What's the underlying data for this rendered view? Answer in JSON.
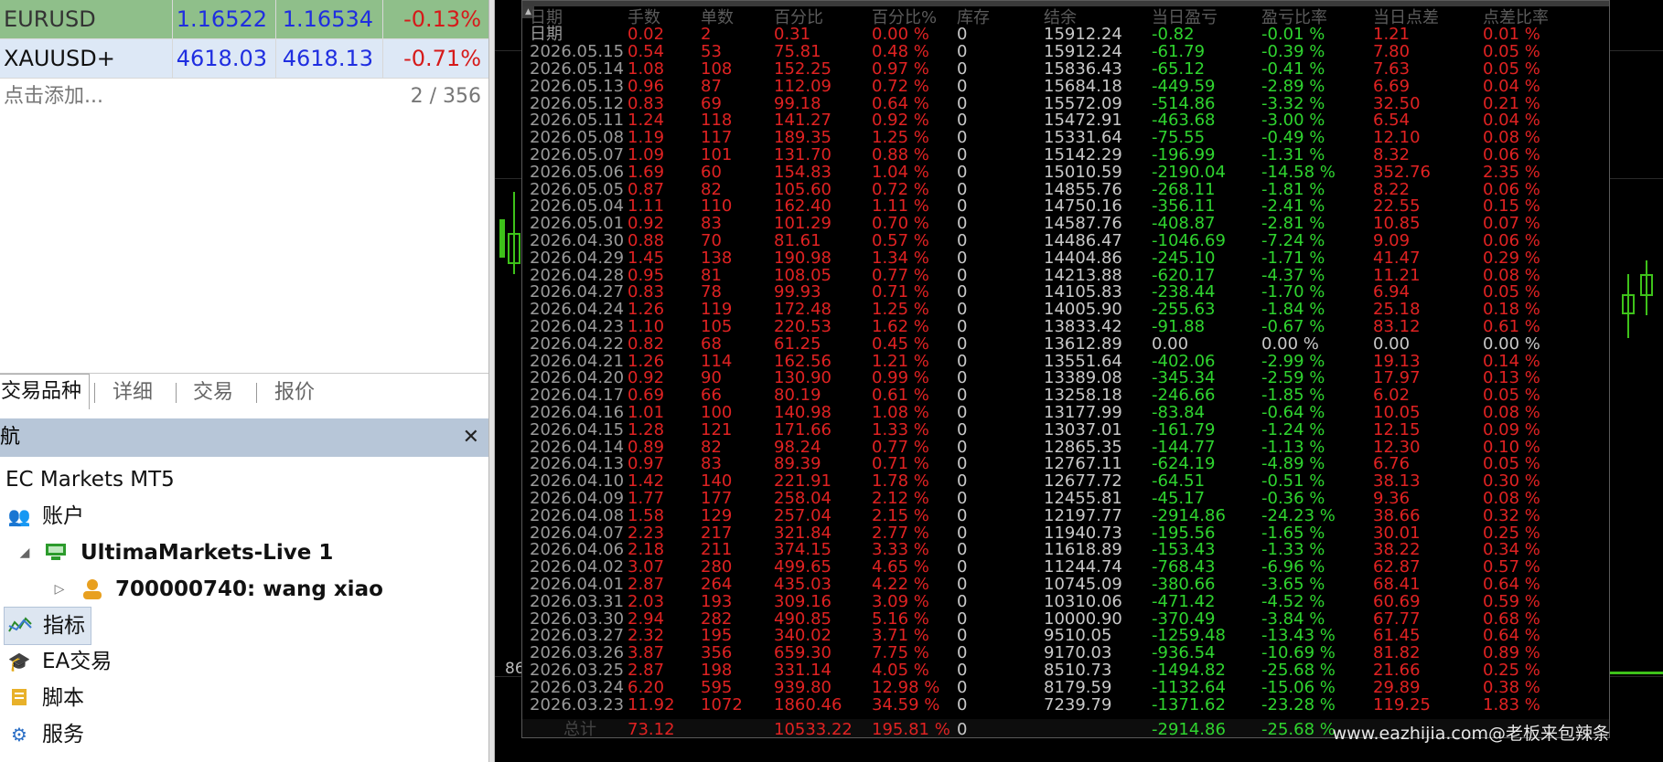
{
  "quotes": [
    {
      "symbol": "EURUSD",
      "bid": "1.16522",
      "ask": "1.16534",
      "change": "-0.13%"
    },
    {
      "symbol": "XAUUSD+",
      "bid": "4618.03",
      "ask": "4618.13",
      "change": "-0.71%"
    }
  ],
  "add_row": {
    "label": "点击添加...",
    "count": "2 / 356"
  },
  "tabs": [
    "交易品种",
    "详细",
    "交易",
    "报价"
  ],
  "navigator": {
    "title": "航",
    "close": "✕",
    "items": [
      {
        "label": "EC Markets MT5",
        "icon": "broker-icon"
      },
      {
        "label": "账户",
        "icon": "accounts-icon"
      },
      {
        "label": "UltimaMarkets-Live 1",
        "icon": "server-icon"
      },
      {
        "label": "700000740: wang xiao",
        "icon": "user-icon"
      },
      {
        "label": "指标",
        "icon": "indicators-icon"
      },
      {
        "label": "EA交易",
        "icon": "expert-advisor-icon"
      },
      {
        "label": "脚本",
        "icon": "scripts-icon"
      },
      {
        "label": "服务",
        "icon": "services-icon"
      }
    ]
  },
  "chart": {
    "left_label": "86"
  },
  "stats": {
    "header": [
      "日期",
      "手数",
      "单数",
      "百分比",
      "百分比%",
      "库存",
      "结余",
      "当日盈亏",
      "盈亏比率",
      "当日点差",
      "点差比率"
    ],
    "rows": [
      [
        "日期",
        "0.02",
        "2",
        "0.31",
        "0.00 %",
        "0",
        "15912.24",
        "-0.82",
        "-0.01 %",
        "1.21",
        "0.01 %"
      ],
      [
        "2026.05.15",
        "0.54",
        "53",
        "75.81",
        "0.48 %",
        "0",
        "15912.24",
        "-61.79",
        "-0.39 %",
        "7.80",
        "0.05 %"
      ],
      [
        "2026.05.14",
        "1.08",
        "108",
        "152.25",
        "0.97 %",
        "0",
        "15836.43",
        "-65.12",
        "-0.41 %",
        "7.63",
        "0.05 %"
      ],
      [
        "2026.05.13",
        "0.96",
        "87",
        "112.09",
        "0.72 %",
        "0",
        "15684.18",
        "-449.59",
        "-2.89 %",
        "6.69",
        "0.04 %"
      ],
      [
        "2026.05.12",
        "0.83",
        "69",
        "99.18",
        "0.64 %",
        "0",
        "15572.09",
        "-514.86",
        "-3.32 %",
        "32.50",
        "0.21 %"
      ],
      [
        "2026.05.11",
        "1.24",
        "118",
        "141.27",
        "0.92 %",
        "0",
        "15472.91",
        "-463.68",
        "-3.00 %",
        "6.54",
        "0.04 %"
      ],
      [
        "2026.05.08",
        "1.19",
        "117",
        "189.35",
        "1.25 %",
        "0",
        "15331.64",
        "-75.55",
        "-0.49 %",
        "12.10",
        "0.08 %"
      ],
      [
        "2026.05.07",
        "1.09",
        "101",
        "131.70",
        "0.88 %",
        "0",
        "15142.29",
        "-196.99",
        "-1.31 %",
        "8.32",
        "0.06 %"
      ],
      [
        "2026.05.06",
        "1.69",
        "60",
        "154.83",
        "1.04 %",
        "0",
        "15010.59",
        "-2190.04",
        "-14.58 %",
        "352.76",
        "2.35 %"
      ],
      [
        "2026.05.05",
        "0.87",
        "82",
        "105.60",
        "0.72 %",
        "0",
        "14855.76",
        "-268.11",
        "-1.81 %",
        "8.22",
        "0.06 %"
      ],
      [
        "2026.05.04",
        "1.11",
        "110",
        "162.40",
        "1.11 %",
        "0",
        "14750.16",
        "-356.11",
        "-2.41 %",
        "22.55",
        "0.15 %"
      ],
      [
        "2026.05.01",
        "0.92",
        "83",
        "101.29",
        "0.70 %",
        "0",
        "14587.76",
        "-408.87",
        "-2.81 %",
        "10.85",
        "0.07 %"
      ],
      [
        "2026.04.30",
        "0.88",
        "70",
        "81.61",
        "0.57 %",
        "0",
        "14486.47",
        "-1046.69",
        "-7.24 %",
        "9.09",
        "0.06 %"
      ],
      [
        "2026.04.29",
        "1.45",
        "138",
        "190.98",
        "1.34 %",
        "0",
        "14404.86",
        "-245.10",
        "-1.71 %",
        "41.47",
        "0.29 %"
      ],
      [
        "2026.04.28",
        "0.95",
        "81",
        "108.05",
        "0.77 %",
        "0",
        "14213.88",
        "-620.17",
        "-4.37 %",
        "11.21",
        "0.08 %"
      ],
      [
        "2026.04.27",
        "0.83",
        "78",
        "99.93",
        "0.71 %",
        "0",
        "14105.83",
        "-238.44",
        "-1.70 %",
        "6.94",
        "0.05 %"
      ],
      [
        "2026.04.24",
        "1.26",
        "119",
        "172.48",
        "1.25 %",
        "0",
        "14005.90",
        "-255.63",
        "-1.84 %",
        "25.18",
        "0.18 %"
      ],
      [
        "2026.04.23",
        "1.10",
        "105",
        "220.53",
        "1.62 %",
        "0",
        "13833.42",
        "-91.88",
        "-0.67 %",
        "83.12",
        "0.61 %"
      ],
      [
        "2026.04.22",
        "0.82",
        "68",
        "61.25",
        "0.45 %",
        "0",
        "13612.89",
        "0.00",
        "0.00 %",
        "0.00",
        "0.00 %"
      ],
      [
        "2026.04.21",
        "1.26",
        "114",
        "162.56",
        "1.21 %",
        "0",
        "13551.64",
        "-402.06",
        "-2.99 %",
        "19.13",
        "0.14 %"
      ],
      [
        "2026.04.20",
        "0.92",
        "90",
        "130.90",
        "0.99 %",
        "0",
        "13389.08",
        "-345.34",
        "-2.59 %",
        "17.97",
        "0.13 %"
      ],
      [
        "2026.04.17",
        "0.69",
        "66",
        "80.19",
        "0.61 %",
        "0",
        "13258.18",
        "-246.66",
        "-1.85 %",
        "6.02",
        "0.05 %"
      ],
      [
        "2026.04.16",
        "1.01",
        "100",
        "140.98",
        "1.08 %",
        "0",
        "13177.99",
        "-83.84",
        "-0.64 %",
        "10.05",
        "0.08 %"
      ],
      [
        "2026.04.15",
        "1.28",
        "121",
        "171.66",
        "1.33 %",
        "0",
        "13037.01",
        "-161.79",
        "-1.24 %",
        "12.15",
        "0.09 %"
      ],
      [
        "2026.04.14",
        "0.89",
        "82",
        "98.24",
        "0.77 %",
        "0",
        "12865.35",
        "-144.77",
        "-1.13 %",
        "12.30",
        "0.10 %"
      ],
      [
        "2026.04.13",
        "0.97",
        "83",
        "89.39",
        "0.71 %",
        "0",
        "12767.11",
        "-624.19",
        "-4.89 %",
        "6.76",
        "0.05 %"
      ],
      [
        "2026.04.10",
        "1.42",
        "140",
        "221.91",
        "1.78 %",
        "0",
        "12677.72",
        "-64.51",
        "-0.51 %",
        "38.13",
        "0.30 %"
      ],
      [
        "2026.04.09",
        "1.77",
        "177",
        "258.04",
        "2.12 %",
        "0",
        "12455.81",
        "-45.17",
        "-0.36 %",
        "9.36",
        "0.08 %"
      ],
      [
        "2026.04.08",
        "1.58",
        "129",
        "257.04",
        "2.15 %",
        "0",
        "12197.77",
        "-2914.86",
        "-24.23 %",
        "38.66",
        "0.32 %"
      ],
      [
        "2026.04.07",
        "2.23",
        "217",
        "321.84",
        "2.77 %",
        "0",
        "11940.73",
        "-195.56",
        "-1.65 %",
        "30.01",
        "0.25 %"
      ],
      [
        "2026.04.06",
        "2.18",
        "211",
        "374.15",
        "3.33 %",
        "0",
        "11618.89",
        "-153.43",
        "-1.33 %",
        "38.22",
        "0.34 %"
      ],
      [
        "2026.04.02",
        "3.07",
        "280",
        "499.65",
        "4.65 %",
        "0",
        "11244.74",
        "-768.43",
        "-6.96 %",
        "62.87",
        "0.57 %"
      ],
      [
        "2026.04.01",
        "2.87",
        "264",
        "435.03",
        "4.22 %",
        "0",
        "10745.09",
        "-380.66",
        "-3.65 %",
        "68.41",
        "0.64 %"
      ],
      [
        "2026.03.31",
        "2.03",
        "193",
        "309.16",
        "3.09 %",
        "0",
        "10310.06",
        "-471.42",
        "-4.52 %",
        "60.69",
        "0.59 %"
      ],
      [
        "2026.03.30",
        "2.94",
        "282",
        "490.85",
        "5.16 %",
        "0",
        "10000.90",
        "-370.49",
        "-3.84 %",
        "67.77",
        "0.68 %"
      ],
      [
        "2026.03.27",
        "2.32",
        "195",
        "340.02",
        "3.71 %",
        "0",
        "9510.05",
        "-1259.48",
        "-13.43 %",
        "61.45",
        "0.64 %"
      ],
      [
        "2026.03.26",
        "3.87",
        "356",
        "659.30",
        "7.75 %",
        "0",
        "9170.03",
        "-936.54",
        "-10.69 %",
        "81.82",
        "0.89 %"
      ],
      [
        "2026.03.25",
        "2.87",
        "198",
        "331.14",
        "4.05 %",
        "0",
        "8510.73",
        "-1494.82",
        "-25.68 %",
        "21.66",
        "0.25 %"
      ],
      [
        "2026.03.24",
        "6.20",
        "595",
        "939.80",
        "12.98 %",
        "0",
        "8179.59",
        "-1132.64",
        "-15.06 %",
        "29.89",
        "0.38 %"
      ],
      [
        "2026.03.23",
        "11.92",
        "1072",
        "1860.46",
        "34.59 %",
        "0",
        "7239.79",
        "-1371.62",
        "-23.28 %",
        "119.25",
        "1.83 %"
      ]
    ],
    "totals": [
      "总计",
      "73.12",
      "",
      "10533.22",
      "195.81 %",
      "0",
      "",
      "-2914.86",
      "-25.68 %",
      "",
      ""
    ]
  },
  "watermark": "www.eazhijia.com@老板来包辣条"
}
